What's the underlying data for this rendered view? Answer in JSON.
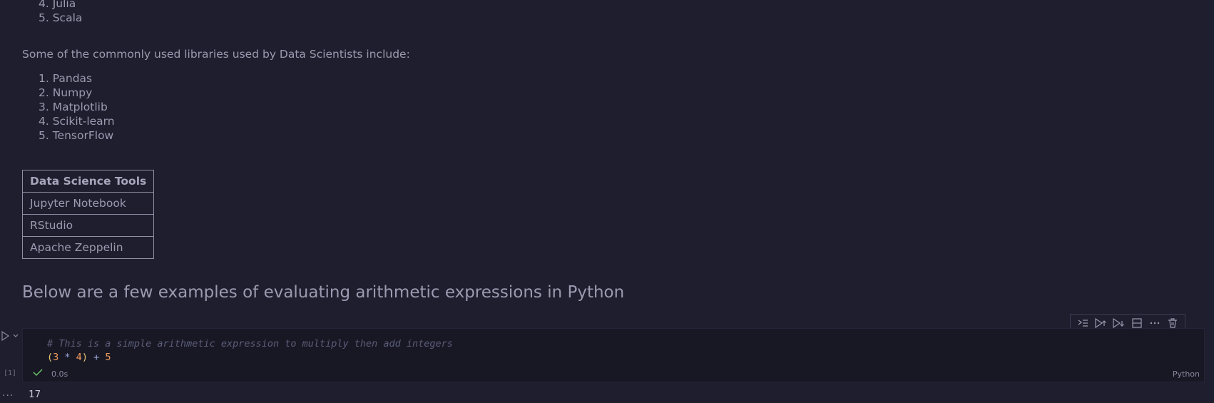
{
  "languages_tail": [
    "4. Julia",
    "5. Scala"
  ],
  "libraries_intro": "Some of the commonly used libraries used by Data Scientists include:",
  "libraries": [
    "1. Pandas",
    "2. Numpy",
    "3. Matplotlib",
    "4. Scikit-learn",
    "5. TensorFlow"
  ],
  "tools_table": {
    "header": "Data Science Tools",
    "rows": [
      "Jupyter Notebook",
      "RStudio",
      "Apache Zeppelin"
    ]
  },
  "section_heading": "Below are a few examples of evaluating arithmetic expressions in Python",
  "code_cell": {
    "comment": "# This is a simple arithmetic expression to multiply then add integers",
    "expr": {
      "open": "(",
      "a": "3",
      "op1": " * ",
      "b": "4",
      "close": ")",
      "op2": " + ",
      "c": "5"
    },
    "execution_count": "[1]",
    "status_time": "0.0s",
    "language": "Python",
    "output": "17"
  },
  "icons": {
    "run": "run-cell-icon",
    "toolbar": [
      "execute-above-icon",
      "execute-cell-and-above-icon",
      "execute-cell-and-below-icon",
      "split-cell-icon",
      "more-actions-icon",
      "delete-cell-icon"
    ]
  },
  "colors": {
    "background": "#1e1e2e",
    "cell_background": "#181825",
    "comment": "#5b5d78",
    "number": "#f19a5b",
    "paren": "#e5c36b",
    "success": "#6bc46b"
  }
}
